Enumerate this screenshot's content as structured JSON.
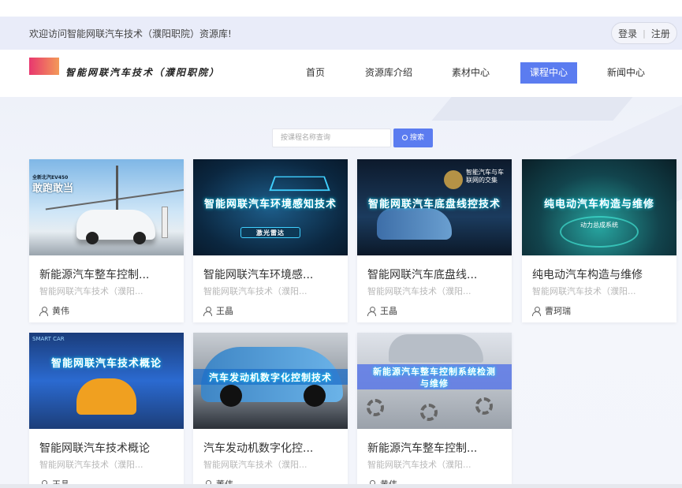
{
  "topbar": {
    "welcome": "欢迎访问智能网联汽车技术（濮阳职院）资源库!",
    "login": "登录",
    "separator": "|",
    "register": "注册"
  },
  "header": {
    "logo_text": "智能网联汽车技术（濮阳职院）",
    "nav": [
      {
        "label": "首页",
        "active": false
      },
      {
        "label": "资源库介绍",
        "active": false
      },
      {
        "label": "素材中心",
        "active": false
      },
      {
        "label": "课程中心",
        "active": true
      },
      {
        "label": "新闻中心",
        "active": false
      }
    ]
  },
  "search": {
    "placeholder": "按课程名称查询",
    "button_label": "搜索"
  },
  "courses": [
    {
      "title": "新能源汽车整车控制...",
      "subtitle": "智能网联汽车技术（濮阳...",
      "teacher": "黄伟",
      "thumb_text": "敢跑敢当",
      "thumb_brand": "全新北汽EV450"
    },
    {
      "title": "智能网联汽车环境感...",
      "subtitle": "智能网联汽车技术（濮阳...",
      "teacher": "王晶",
      "thumb_text": "智能网联汽车环境感知技术",
      "thumb_sub": "激光雷达"
    },
    {
      "title": "智能网联汽车底盘线...",
      "subtitle": "智能网联汽车技术（濮阳...",
      "teacher": "王晶",
      "thumb_text": "智能网联汽车底盘线控技术",
      "thumb_sub": "智能汽车与车联网的交集"
    },
    {
      "title": "纯电动汽车构造与维修",
      "subtitle": "智能网联汽车技术（濮阳...",
      "teacher": "曹珂瑞",
      "thumb_text": "纯电动汽车构造与维修",
      "thumb_sub": "动力总成系统"
    },
    {
      "title": "智能网联汽车技术概论",
      "subtitle": "智能网联汽车技术（濮阳...",
      "teacher": "王晶",
      "thumb_text": "智能网联汽车技术概论",
      "thumb_sub": "SMART CAR"
    },
    {
      "title": "汽车发动机数字化控...",
      "subtitle": "智能网联汽车技术（濮阳...",
      "teacher": "董伟",
      "thumb_text": "汽车发动机数字化控制技术"
    },
    {
      "title": "新能源汽车整车控制...",
      "subtitle": "智能网联汽车技术（濮阳...",
      "teacher": "黄伟",
      "thumb_text": "新能源汽车整车控制系统检测与维修"
    }
  ],
  "colors": {
    "accent": "#5b7cf0",
    "topbar_bg": "#e9ecf9",
    "page_bg": "#f3f5fb"
  }
}
